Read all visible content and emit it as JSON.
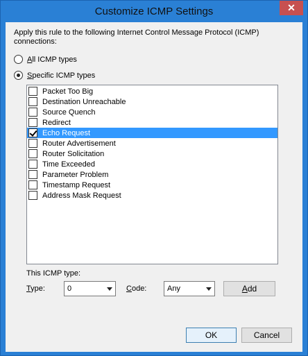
{
  "window": {
    "title": "Customize ICMP Settings",
    "close_glyph": "✕"
  },
  "intro_text": "Apply this rule to the following Internet Control Message Protocol (ICMP) connections:",
  "radios": {
    "all": {
      "prefix": "",
      "accel": "A",
      "rest": "ll ICMP types",
      "checked": false
    },
    "specific": {
      "prefix": "",
      "accel": "S",
      "rest": "pecific ICMP types",
      "checked": true
    }
  },
  "icmp_list": [
    {
      "label": "Packet Too Big",
      "checked": false,
      "selected": false
    },
    {
      "label": "Destination Unreachable",
      "checked": false,
      "selected": false
    },
    {
      "label": "Source Quench",
      "checked": false,
      "selected": false
    },
    {
      "label": "Redirect",
      "checked": false,
      "selected": false
    },
    {
      "label": "Echo Request",
      "checked": true,
      "selected": true
    },
    {
      "label": "Router Advertisement",
      "checked": false,
      "selected": false
    },
    {
      "label": "Router Solicitation",
      "checked": false,
      "selected": false
    },
    {
      "label": "Time Exceeded",
      "checked": false,
      "selected": false
    },
    {
      "label": "Parameter Problem",
      "checked": false,
      "selected": false
    },
    {
      "label": "Timestamp Request",
      "checked": false,
      "selected": false
    },
    {
      "label": "Address Mask Request",
      "checked": false,
      "selected": false
    }
  ],
  "this_type": {
    "heading": "This ICMP type:",
    "type_label_accel": "T",
    "type_label_rest": "ype:",
    "type_value": "0",
    "code_label_accel": "C",
    "code_label_rest": "ode:",
    "code_value": "Any",
    "add_accel": "A",
    "add_rest": "dd"
  },
  "buttons": {
    "ok": "OK",
    "cancel": "Cancel"
  },
  "colors": {
    "title_bar": "#2a80d5",
    "selection": "#3399ff",
    "close": "#c75050"
  }
}
